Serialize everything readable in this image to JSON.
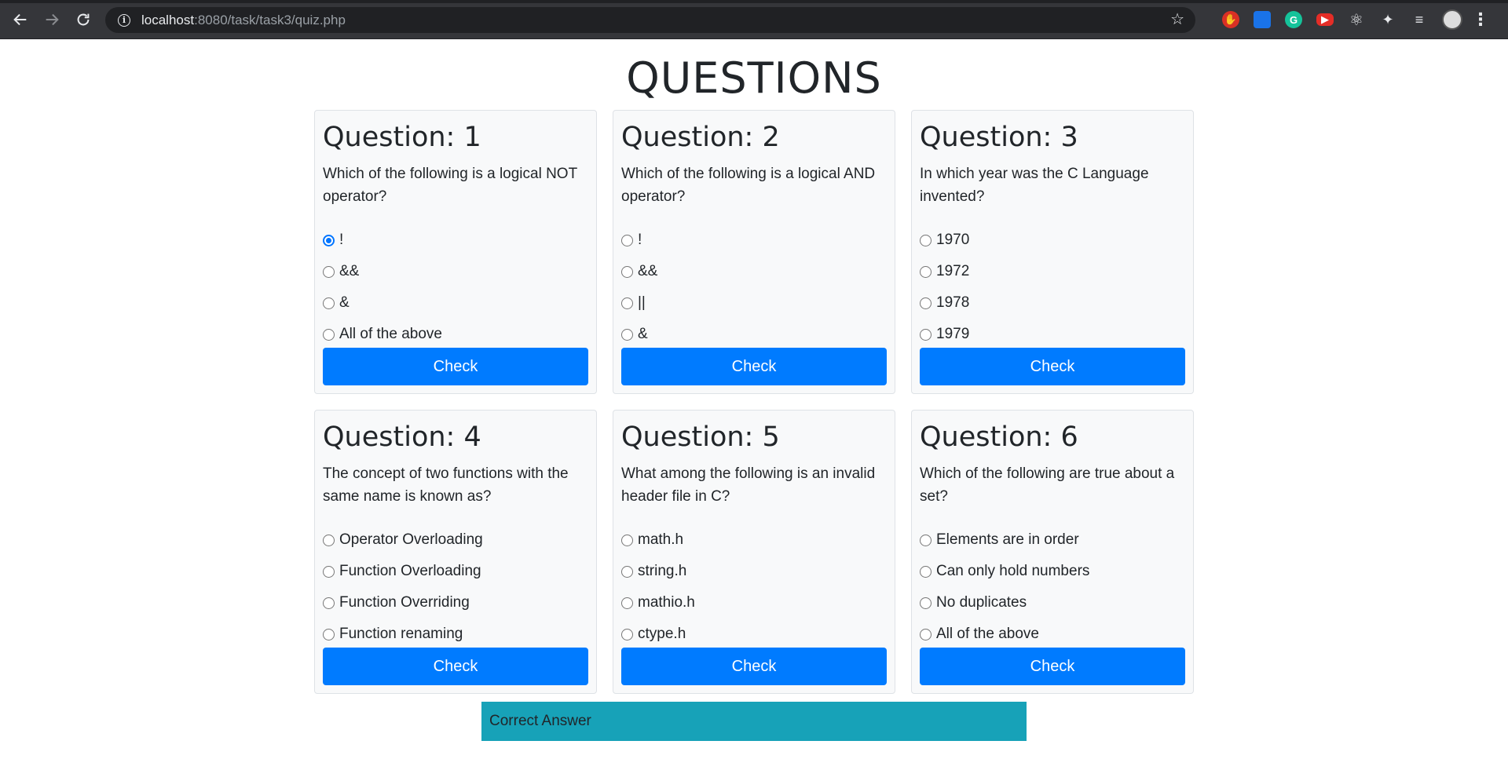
{
  "browser": {
    "url_host": "localhost",
    "url_path": ":8080/task/task3/quiz.php"
  },
  "page": {
    "title": "QUESTIONS"
  },
  "questions": [
    {
      "heading": "Question: 1",
      "text": "Which of the following is a logical NOT operator?",
      "options": [
        "!",
        "&&",
        "&",
        "All of the above"
      ],
      "selected": 0,
      "button": "Check"
    },
    {
      "heading": "Question: 2",
      "text": "Which of the following is a logical AND operator?",
      "options": [
        "!",
        "&&",
        "||",
        "&"
      ],
      "selected": -1,
      "button": "Check"
    },
    {
      "heading": "Question: 3",
      "text": "In which year was the C Language invented?",
      "options": [
        "1970",
        "1972",
        "1978",
        "1979"
      ],
      "selected": -1,
      "button": "Check"
    },
    {
      "heading": "Question: 4",
      "text": "The concept of two functions with the same name is known as?",
      "options": [
        "Operator Overloading",
        "Function Overloading",
        "Function Overriding",
        "Function renaming"
      ],
      "selected": -1,
      "button": "Check"
    },
    {
      "heading": "Question: 5",
      "text": "What among the following is an invalid header file in C?",
      "options": [
        "math.h",
        "string.h",
        "mathio.h",
        "ctype.h"
      ],
      "selected": -1,
      "button": "Check"
    },
    {
      "heading": "Question: 6",
      "text": "Which of the following are true about a set?",
      "options": [
        "Elements are in order",
        "Can only hold numbers",
        "No duplicates",
        "All of the above"
      ],
      "selected": -1,
      "button": "Check"
    }
  ],
  "result": {
    "message": "Correct Answer"
  },
  "colors": {
    "primary": "#007bff",
    "info": "#17a2b8",
    "card_bg": "#f8f9fa"
  }
}
